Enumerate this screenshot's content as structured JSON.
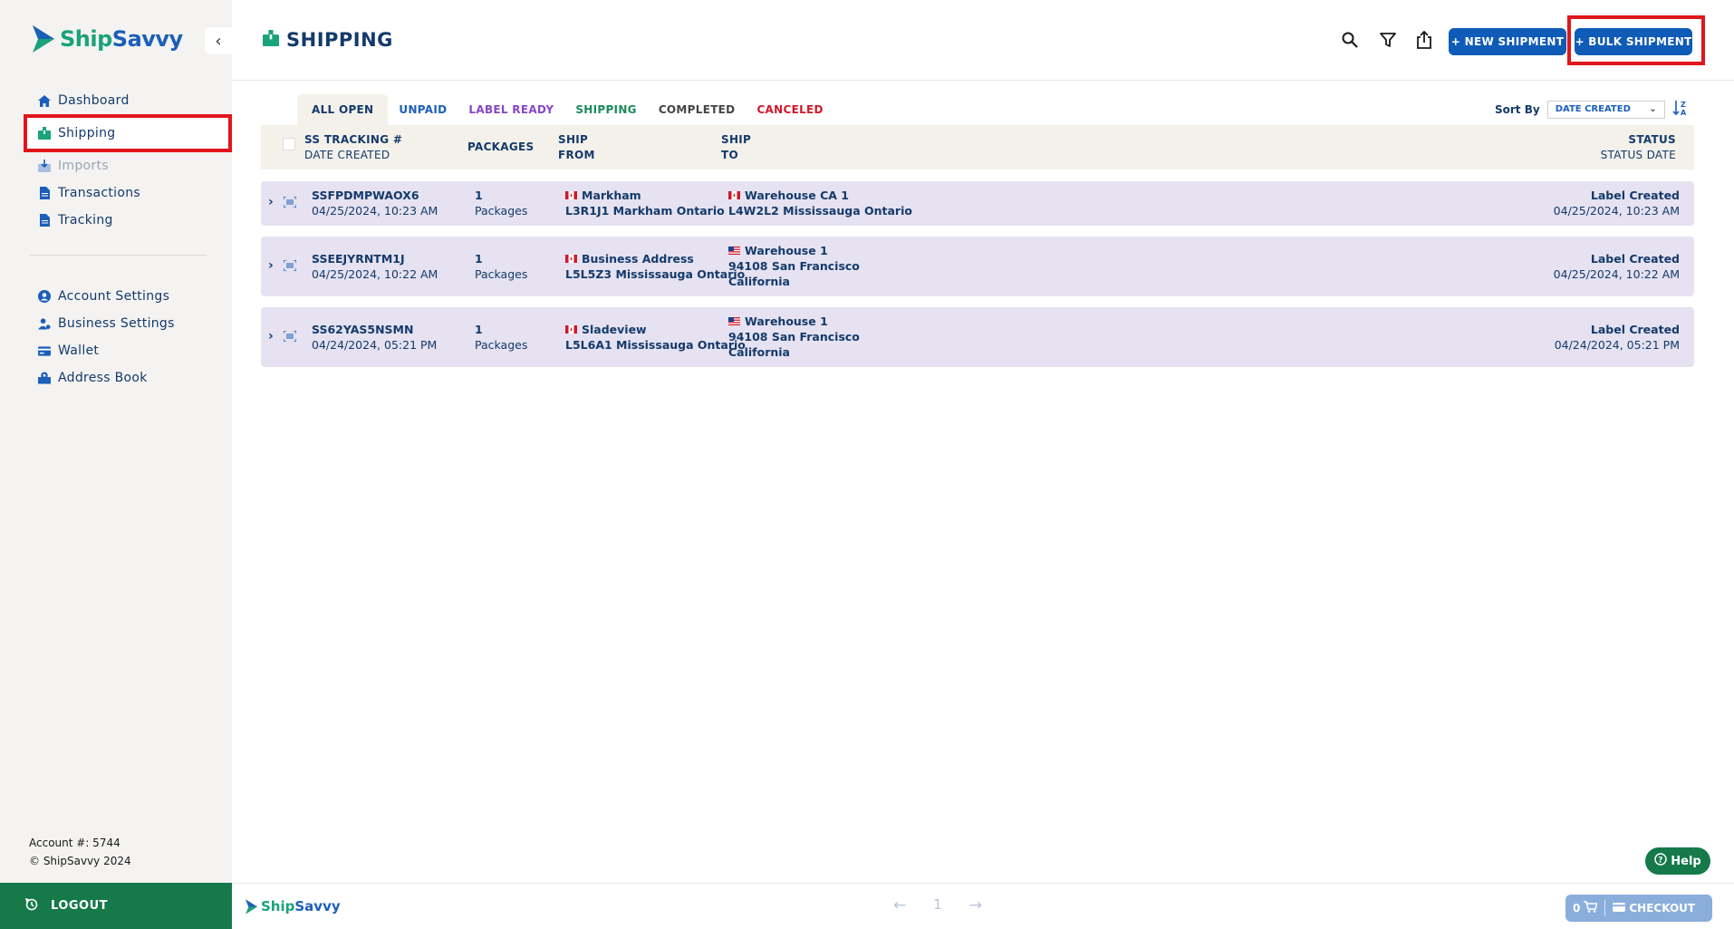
{
  "brand": {
    "ship": "Ship",
    "savvy": "Savvy"
  },
  "sidebar": {
    "items": [
      {
        "label": "Dashboard"
      },
      {
        "label": "Shipping"
      },
      {
        "label": "Imports"
      },
      {
        "label": "Transactions"
      },
      {
        "label": "Tracking"
      }
    ],
    "settings": [
      {
        "label": "Account Settings"
      },
      {
        "label": "Business Settings"
      },
      {
        "label": "Wallet"
      },
      {
        "label": "Address Book"
      }
    ],
    "account_number": "Account #: 5744",
    "copyright": "© ShipSavvy 2024",
    "logout_label": "LOGOUT"
  },
  "header": {
    "title": "SHIPPING",
    "new_shipment_label": "+ NEW SHIPMENT",
    "bulk_shipment_label": "+ BULK SHIPMENT"
  },
  "tabs": [
    {
      "label": "ALL OPEN",
      "color": "#143a6b"
    },
    {
      "label": "UNPAID",
      "color": "#1c5fb8"
    },
    {
      "label": "LABEL READY",
      "color": "#8a46c4"
    },
    {
      "label": "SHIPPING",
      "color": "#1a8a5a"
    },
    {
      "label": "COMPLETED",
      "color": "#444444"
    },
    {
      "label": "CANCELED",
      "color": "#d0182a"
    }
  ],
  "sort": {
    "label": "Sort By",
    "value": "DATE CREATED"
  },
  "table": {
    "headers": {
      "tracking": "SS TRACKING #",
      "date_created": "DATE CREATED",
      "packages": "PACKAGES",
      "ship_from_1": "SHIP",
      "ship_from_2": "FROM",
      "ship_to_1": "SHIP",
      "ship_to_2": "TO",
      "status": "STATUS",
      "status_date": "STATUS DATE"
    },
    "rows": [
      {
        "tracking": "SSFPDMPWAOX6",
        "date": "04/25/2024, 10:23 AM",
        "packages_count": "1",
        "packages_label": "Packages",
        "from_name": "Markham",
        "from_addr": "L3R1J1 Markham Ontario",
        "to_name": "Warehouse CA 1",
        "to_addr": "L4W2L2 Mississauga Ontario",
        "to_addr2": "",
        "status": "Label Created",
        "status_date": "04/25/2024, 10:23 AM"
      },
      {
        "tracking": "SSEEJYRNTM1J",
        "date": "04/25/2024, 10:22 AM",
        "packages_count": "1",
        "packages_label": "Packages",
        "from_name": "Business Address",
        "from_addr": "L5L5Z3 Mississauga Ontario",
        "to_name": "Warehouse 1",
        "to_addr": "94108 San Francisco",
        "to_addr2": "California",
        "status": "Label Created",
        "status_date": "04/25/2024, 10:22 AM"
      },
      {
        "tracking": "SS62YAS5NSMN",
        "date": "04/24/2024, 05:21 PM",
        "packages_count": "1",
        "packages_label": "Packages",
        "from_name": "Sladeview",
        "from_addr": "L5L6A1 Mississauga Ontario",
        "to_name": "Warehouse 1",
        "to_addr": "94108 San Francisco",
        "to_addr2": "California",
        "status": "Label Created",
        "status_date": "04/24/2024, 05:21 PM"
      }
    ]
  },
  "footer": {
    "page": "1",
    "cart_count": "0",
    "checkout_label": "CHECKOUT",
    "help_label": "Help"
  }
}
